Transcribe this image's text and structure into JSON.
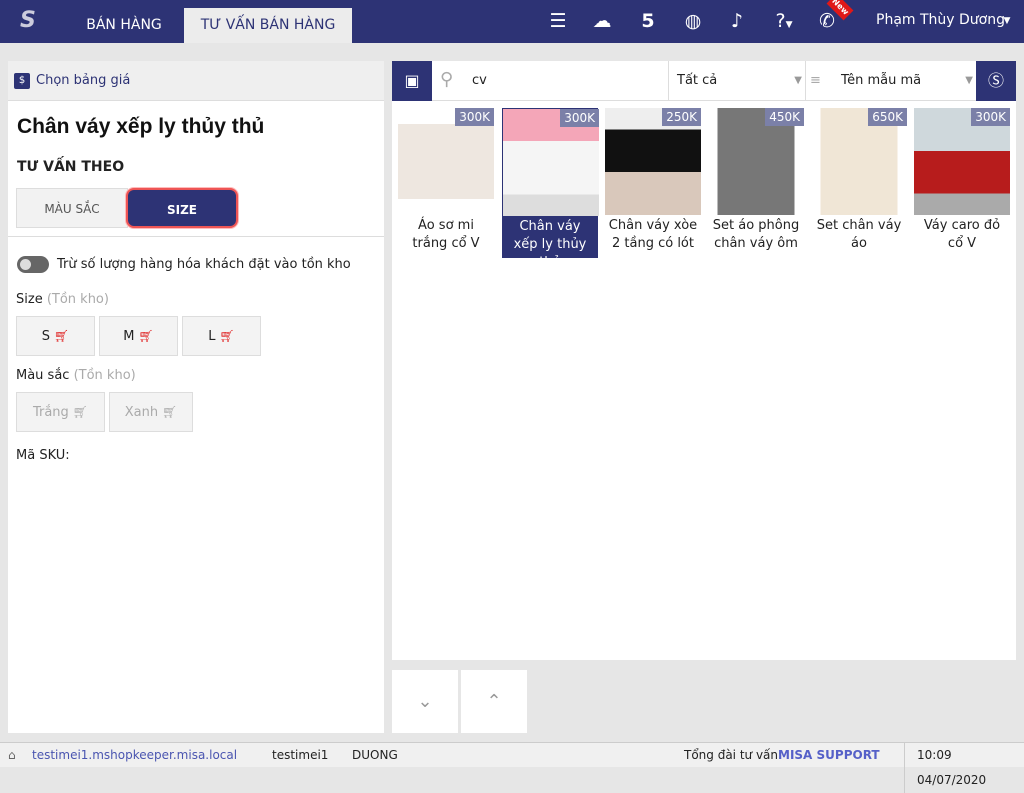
{
  "header": {
    "tabs": [
      {
        "label": "BÁN HÀNG"
      },
      {
        "label": "TƯ VẤN BÁN HÀNG"
      }
    ],
    "user": "Phạm Thùy Dương",
    "new_badge": "New"
  },
  "left": {
    "price_list": "Chọn bảng giá",
    "product_title": "Chân váy xếp ly thủy thủ",
    "consult_by": "TƯ VẤN THEO",
    "seg": [
      "MÀU SẮC",
      "SIZE"
    ],
    "toggle_label": "Trừ số lượng hàng hóa khách đặt vào tồn kho",
    "size_label": "Size",
    "stock_hint": "(Tồn kho)",
    "sizes": [
      "S",
      "M",
      "L"
    ],
    "color_label": "Màu sắc",
    "colors": [
      "Trắng",
      "Xanh"
    ],
    "sku_label": "Mã SKU:"
  },
  "right": {
    "search_value": "cv",
    "filter": "Tất cả",
    "sort": "Tên mẫu mã",
    "products": [
      {
        "name": "Áo sơ mi trắng cổ V",
        "price": "300K"
      },
      {
        "name": "Chân váy xếp ly thủy thủ",
        "price": "300K"
      },
      {
        "name": "Chân váy xòe 2 tầng có lót",
        "price": "250K"
      },
      {
        "name": "Set áo phông chân váy ôm",
        "price": "450K"
      },
      {
        "name": "Set chân váy áo",
        "price": "650K"
      },
      {
        "name": "Váy caro đỏ cổ V",
        "price": "300K"
      }
    ]
  },
  "status": {
    "domain": "testimei1.mshopkeeper.misa.local",
    "account": "testimei1",
    "user": "DUONG",
    "hotline_label": "Tổng đài tư vấn:",
    "hotline": "MISA SUPPORT",
    "datetime": "10:09 04/07/2020"
  }
}
